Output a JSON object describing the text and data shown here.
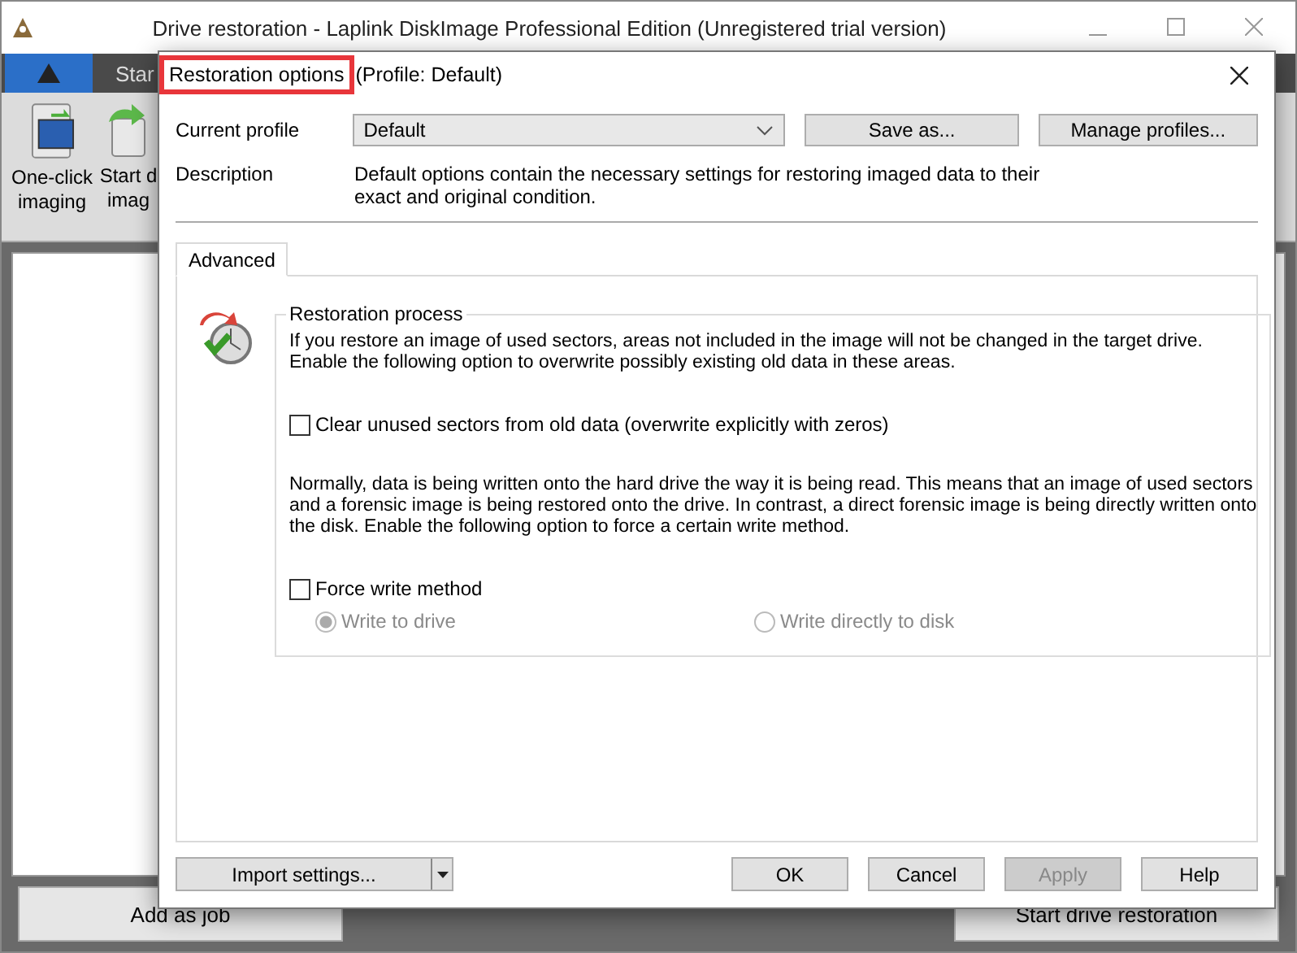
{
  "app_window": {
    "title": "Drive restoration - Laplink DiskImage Professional Edition (Unregistered trial version)",
    "ribbon_tabs": [
      {
        "label": "Star"
      }
    ],
    "toolbar": [
      {
        "lines": [
          "One-click",
          "imaging"
        ]
      },
      {
        "lines": [
          "Start d",
          "imag"
        ]
      }
    ],
    "bottom_buttons": [
      "Add as job",
      "Start drive restoration"
    ]
  },
  "dialog": {
    "title": "Restoration options",
    "subtitle": "(Profile: Default)",
    "profile_label": "Current profile",
    "profile_value": "Default",
    "profile_buttons": [
      "Save as...",
      "Manage profiles..."
    ],
    "description_label": "Description",
    "description_lines": [
      "Default options contain the necessary settings for restoring imaged data to their",
      "exact and original condition."
    ],
    "tabs": [
      {
        "label": "Advanced",
        "selected": true
      }
    ],
    "group": {
      "title": "Restoration process",
      "items": [
        {
          "kind": "paragraph",
          "lines": [
            "If you restore an image of used sectors, areas not included in the image will not be changed in the target drive.",
            "Enable the following option to overwrite possibly existing old data in these areas."
          ]
        },
        {
          "kind": "checkbox",
          "label": "Clear unused sectors from old data (overwrite explicitly with zeros)",
          "checked": false
        },
        {
          "kind": "paragraph",
          "lines": [
            "Normally, data is being written onto the hard drive the way it is being read. This means that an image of used sectors",
            "and a forensic image is being restored onto the drive. In contrast, a direct forensic image is being directly written onto",
            "the disk. Enable the following option to force a certain write method."
          ]
        },
        {
          "kind": "checkbox",
          "label": "Force write method",
          "checked": false
        },
        {
          "kind": "radios",
          "options": [
            {
              "label": "Write to drive",
              "selected": true,
              "disabled": true
            },
            {
              "label": "Write directly to disk",
              "selected": false,
              "disabled": true
            }
          ]
        }
      ]
    },
    "import_button": "Import settings...",
    "buttons": [
      {
        "label": "OK",
        "disabled": false
      },
      {
        "label": "Cancel",
        "disabled": false
      },
      {
        "label": "Apply",
        "disabled": true
      },
      {
        "label": "Help",
        "disabled": false
      }
    ]
  }
}
